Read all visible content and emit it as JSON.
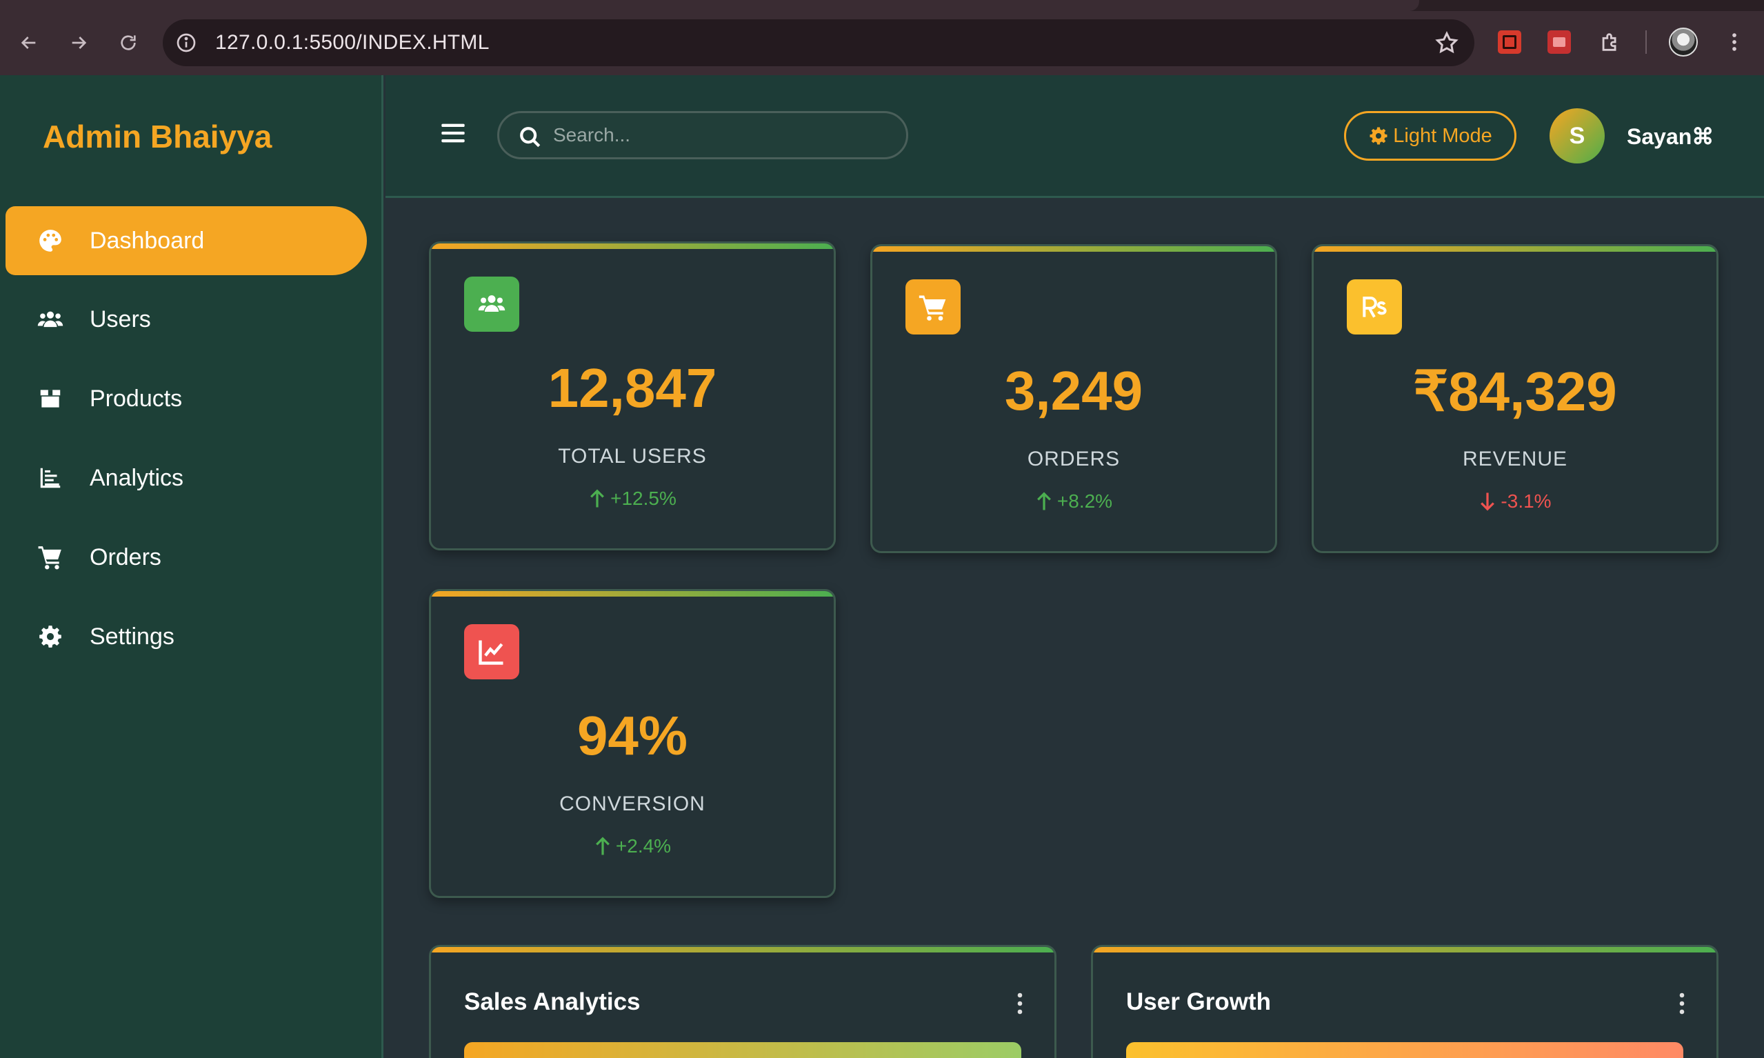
{
  "browser": {
    "url": "127.0.0.1:5500/INDEX.HTML"
  },
  "sidebar": {
    "brand": "Admin Bhaiyya",
    "items": [
      {
        "label": "Dashboard",
        "icon": "palette-icon",
        "active": true
      },
      {
        "label": "Users",
        "icon": "users-icon",
        "active": false
      },
      {
        "label": "Products",
        "icon": "box-icon",
        "active": false
      },
      {
        "label": "Analytics",
        "icon": "chart-bar-icon",
        "active": false
      },
      {
        "label": "Orders",
        "icon": "cart-icon",
        "active": false
      },
      {
        "label": "Settings",
        "icon": "gear-icon",
        "active": false
      }
    ]
  },
  "topbar": {
    "search_placeholder": "Search...",
    "mode_button": "Light Mode",
    "avatar_initial": "S",
    "username": "Sayan⌘"
  },
  "stats": [
    {
      "value": "12,847",
      "label": "TOTAL USERS",
      "change": "+12.5%",
      "direction": "up",
      "icon": "users-icon",
      "color": "#4caf50"
    },
    {
      "value": "3,249",
      "label": "ORDERS",
      "change": "+8.2%",
      "direction": "up",
      "icon": "cart-icon",
      "color": "#f5a623"
    },
    {
      "value": "₹84,329",
      "label": "REVENUE",
      "change": "-3.1%",
      "direction": "down",
      "icon": "rupee-icon",
      "color": "#fbc02d"
    },
    {
      "value": "94%",
      "label": "CONVERSION",
      "change": "+2.4%",
      "direction": "up",
      "icon": "line-chart-icon",
      "color": "#ef5350"
    }
  ],
  "charts": [
    {
      "title": "Sales Analytics"
    },
    {
      "title": "User Growth"
    }
  ],
  "colors": {
    "accent": "#f5a623",
    "success": "#4caf50",
    "danger": "#ef5350",
    "sidebar_bg": "#1d4037",
    "main_bg": "#263238"
  }
}
